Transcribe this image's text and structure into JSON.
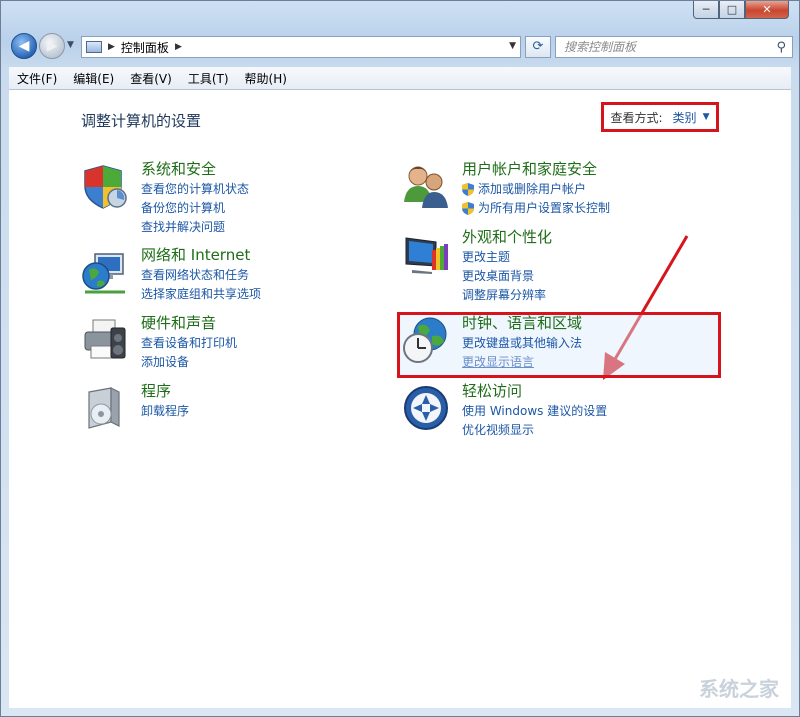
{
  "window": {
    "controls": {
      "minimize": "─",
      "maximize": "□",
      "close": "✕"
    }
  },
  "address_bar": {
    "location": "控制面板",
    "search_placeholder": "搜索控制面板"
  },
  "menu": {
    "items": [
      "文件(F)",
      "编辑(E)",
      "查看(V)",
      "工具(T)",
      "帮助(H)"
    ]
  },
  "main": {
    "title": "调整计算机的设置",
    "view_by_label": "查看方式:",
    "view_by_value": "类别"
  },
  "categories": {
    "system_security": {
      "title": "系统和安全",
      "icon": "shield-icon",
      "links": [
        "查看您的计算机状态",
        "备份您的计算机",
        "查找并解决问题"
      ]
    },
    "network": {
      "title": "网络和 Internet",
      "icon": "network-icon",
      "links": [
        "查看网络状态和任务",
        "选择家庭组和共享选项"
      ]
    },
    "hardware": {
      "title": "硬件和声音",
      "icon": "printer-icon",
      "links": [
        "查看设备和打印机",
        "添加设备"
      ]
    },
    "programs": {
      "title": "程序",
      "icon": "programs-icon",
      "links": [
        "卸载程序"
      ]
    },
    "user_accounts": {
      "title": "用户帐户和家庭安全",
      "icon": "users-icon",
      "links": [
        "添加或删除用户帐户",
        "为所有用户设置家长控制"
      ]
    },
    "appearance": {
      "title": "外观和个性化",
      "icon": "display-icon",
      "links": [
        "更改主题",
        "更改桌面背景",
        "调整屏幕分辨率"
      ]
    },
    "clock": {
      "title": "时钟、语言和区域",
      "icon": "clock-globe-icon",
      "links": [
        "更改键盘或其他输入法",
        "更改显示语言"
      ]
    },
    "ease_access": {
      "title": "轻松访问",
      "icon": "ease-access-icon",
      "links": [
        "使用 Windows 建议的设置",
        "优化视频显示"
      ]
    }
  },
  "watermark": "系统之家",
  "colors": {
    "accent_link": "#1c57a5",
    "category_title": "#1f6d18",
    "annotation_red": "#d7141b"
  }
}
